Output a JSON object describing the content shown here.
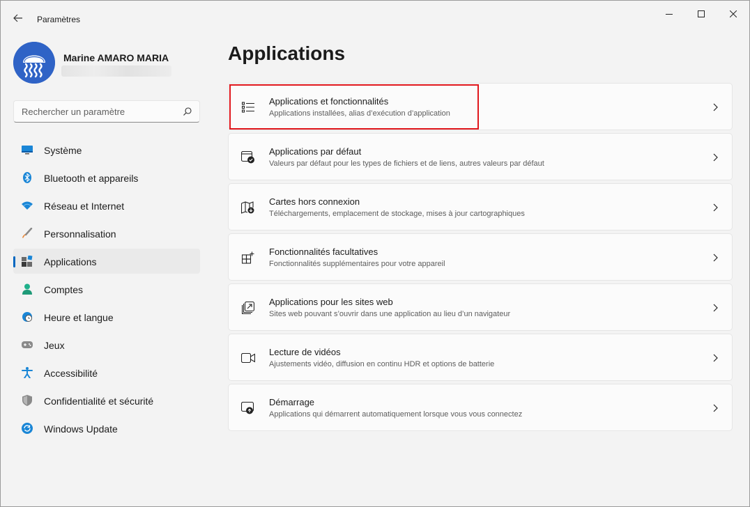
{
  "window": {
    "app_title": "Paramètres"
  },
  "profile": {
    "name": "Marine AMARO MARIA"
  },
  "search": {
    "placeholder": "Rechercher un paramètre"
  },
  "nav": {
    "items": [
      {
        "label": "Système",
        "icon": "monitor-icon"
      },
      {
        "label": "Bluetooth et appareils",
        "icon": "bluetooth-icon"
      },
      {
        "label": "Réseau et Internet",
        "icon": "wifi-icon"
      },
      {
        "label": "Personnalisation",
        "icon": "brush-icon"
      },
      {
        "label": "Applications",
        "icon": "apps-icon",
        "selected": true
      },
      {
        "label": "Comptes",
        "icon": "person-icon"
      },
      {
        "label": "Heure et langue",
        "icon": "clock-globe-icon"
      },
      {
        "label": "Jeux",
        "icon": "gamepad-icon"
      },
      {
        "label": "Accessibilité",
        "icon": "accessibility-icon"
      },
      {
        "label": "Confidentialité et sécurité",
        "icon": "shield-icon"
      },
      {
        "label": "Windows Update",
        "icon": "update-icon"
      }
    ]
  },
  "main": {
    "title": "Applications",
    "cards": [
      {
        "title": "Applications et fonctionnalités",
        "desc": "Applications installées, alias d’exécution d’application",
        "icon": "list-icon"
      },
      {
        "title": "Applications par défaut",
        "desc": "Valeurs par défaut pour les types de fichiers et de liens, autres valeurs par défaut",
        "icon": "default-apps-icon"
      },
      {
        "title": "Cartes hors connexion",
        "desc": "Téléchargements, emplacement de stockage, mises à jour cartographiques",
        "icon": "map-download-icon"
      },
      {
        "title": "Fonctionnalités facultatives",
        "desc": "Fonctionnalités supplémentaires pour votre appareil",
        "icon": "add-feature-icon"
      },
      {
        "title": "Applications pour les sites web",
        "desc": "Sites web pouvant s’ouvrir dans une application au lieu d’un navigateur",
        "icon": "web-apps-icon"
      },
      {
        "title": "Lecture de vidéos",
        "desc": "Ajustements vidéo, diffusion en continu HDR et options de batterie",
        "icon": "video-icon"
      },
      {
        "title": "Démarrage",
        "desc": "Applications qui démarrent automatiquement lorsque vous vous connectez",
        "icon": "startup-icon"
      }
    ]
  },
  "colors": {
    "accent": "#0067c0",
    "highlight": "#e0161c",
    "background": "#f3f3f3",
    "card": "#fbfbfb"
  }
}
